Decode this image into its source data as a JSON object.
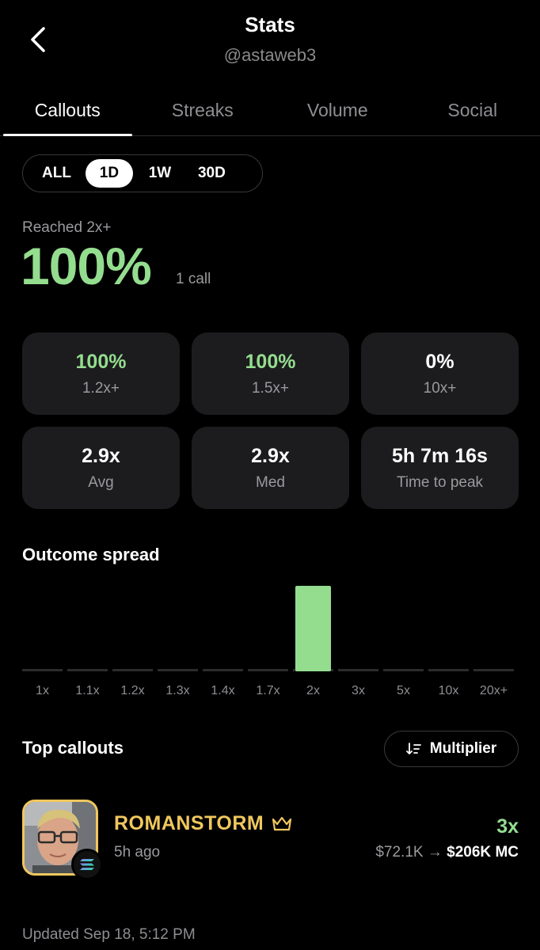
{
  "header": {
    "title": "Stats",
    "handle": "@astaweb3"
  },
  "tabs": [
    {
      "label": "Callouts",
      "active": true
    },
    {
      "label": "Streaks",
      "active": false
    },
    {
      "label": "Volume",
      "active": false
    },
    {
      "label": "Social",
      "active": false
    }
  ],
  "range": {
    "options": [
      "ALL",
      "1D",
      "1W",
      "30D"
    ],
    "selected": "1D"
  },
  "summary": {
    "label": "Reached 2x+",
    "value": "100%",
    "count": "1 call"
  },
  "stats": [
    {
      "value": "100%",
      "label": "1.2x+",
      "accent": true
    },
    {
      "value": "100%",
      "label": "1.5x+",
      "accent": true
    },
    {
      "value": "0%",
      "label": "10x+",
      "accent": false
    },
    {
      "value": "2.9x",
      "label": "Avg",
      "accent": false
    },
    {
      "value": "2.9x",
      "label": "Med",
      "accent": false
    },
    {
      "value": "5h 7m 16s",
      "label": "Time to peak",
      "accent": false
    }
  ],
  "outcome": {
    "title": "Outcome spread"
  },
  "chart_data": {
    "type": "bar",
    "categories": [
      "1x",
      "1.1x",
      "1.2x",
      "1.3x",
      "1.4x",
      "1.7x",
      "2x",
      "3x",
      "5x",
      "10x",
      "20x+"
    ],
    "values": [
      0,
      0,
      0,
      0,
      0,
      0,
      1,
      0,
      0,
      0,
      0
    ],
    "bar_color": "#94dd8f",
    "baseline_color": "#2c2c2e"
  },
  "top": {
    "title": "Top callouts",
    "sort_label": "Multiplier",
    "items": [
      {
        "name": "ROMANSTORM",
        "ago": "5h ago",
        "multiplier": "3x",
        "mc_from": "$72.1K",
        "mc_to": "$206K",
        "mc_unit": "MC"
      }
    ]
  },
  "footer": {
    "updated": "Updated Sep 18, 5:12 PM"
  },
  "colors": {
    "accent": "#94dd8f",
    "gold": "#f0c75e",
    "card": "#1c1c1e",
    "muted": "#9a9a9e"
  },
  "icons": {
    "back": "chevron-left-icon",
    "sort": "sort-icon",
    "crown": "crown-icon",
    "chain": "solana-icon"
  }
}
